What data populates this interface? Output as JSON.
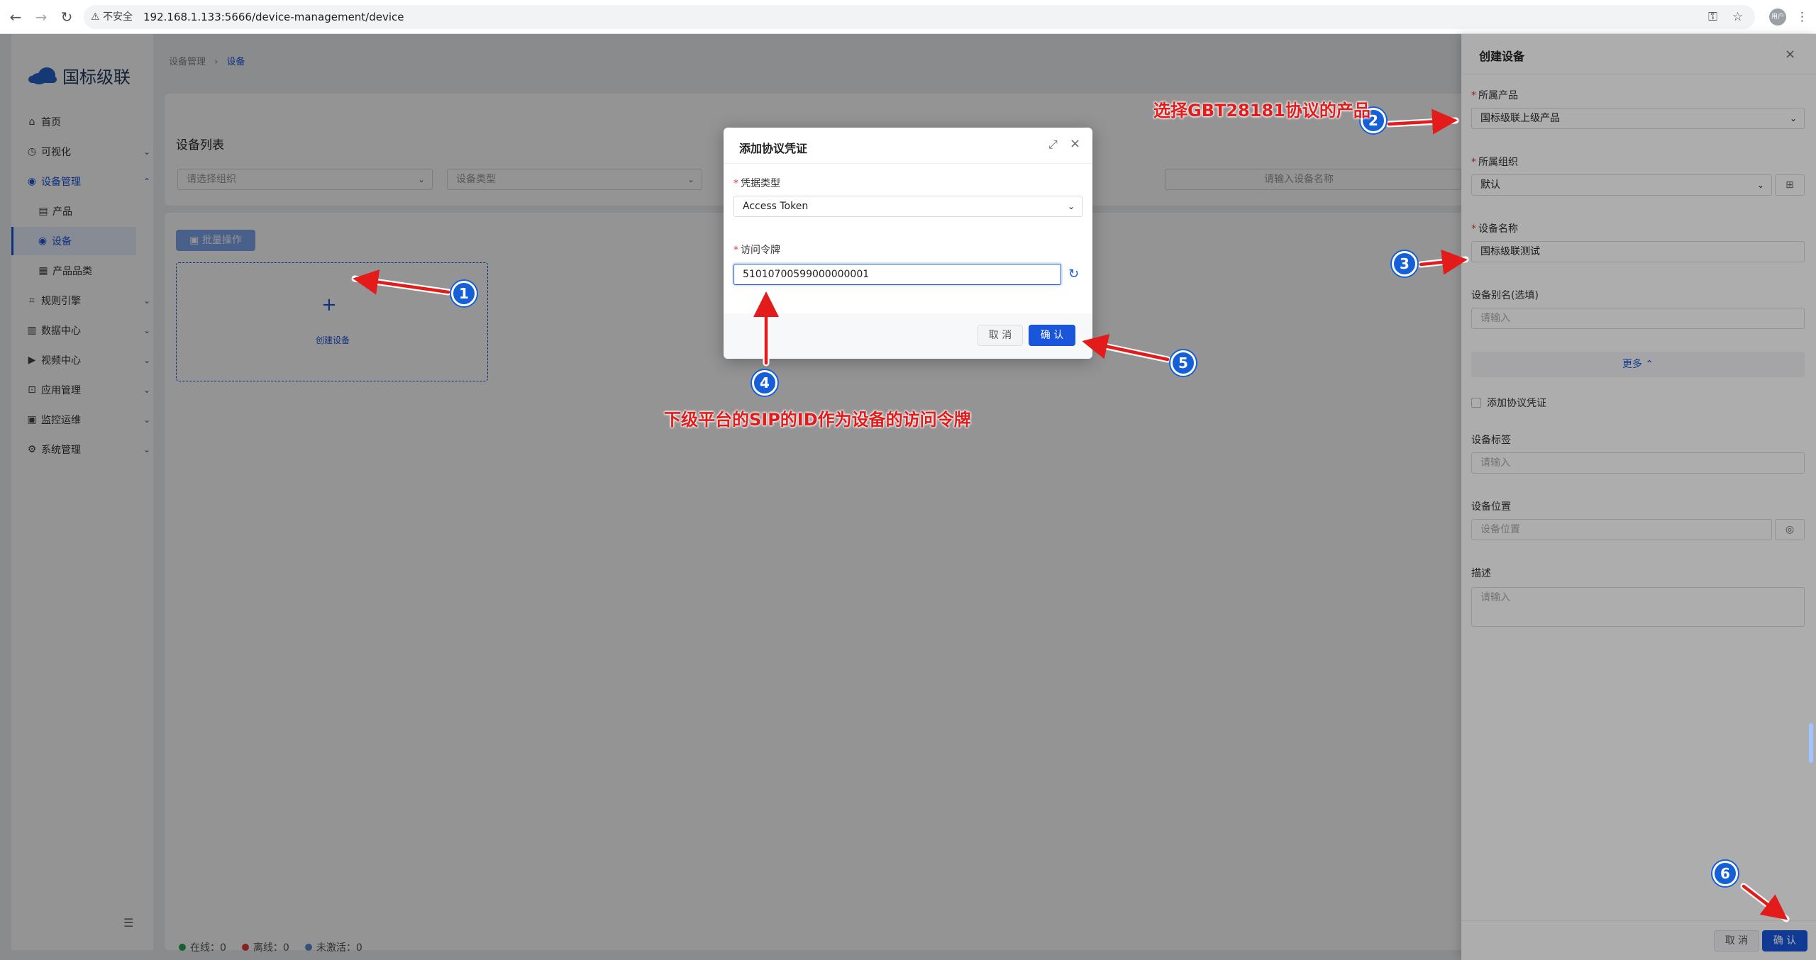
{
  "browser": {
    "insecure_label": "不安全",
    "url": "192.168.1.133:5666/device-management/device",
    "profile": "用户"
  },
  "app": {
    "logo_text": "国标级联",
    "menu": [
      {
        "label": "首页",
        "icon": "home-icon"
      },
      {
        "label": "可视化",
        "icon": "clock-icon"
      },
      {
        "label": "设备管理",
        "icon": "eye-icon"
      },
      {
        "label": "产品",
        "icon": "document-icon"
      },
      {
        "label": "设备",
        "icon": "eye-icon"
      },
      {
        "label": "产品品类",
        "icon": "category-icon"
      },
      {
        "label": "规则引擎",
        "icon": "rule-icon"
      },
      {
        "label": "数据中心",
        "icon": "chart-icon"
      },
      {
        "label": "视频中心",
        "icon": "video-icon"
      },
      {
        "label": "应用管理",
        "icon": "app-icon"
      },
      {
        "label": "监控运维",
        "icon": "monitor-icon"
      },
      {
        "label": "系统管理",
        "icon": "gear-icon"
      }
    ],
    "breadcrumb": {
      "parent": "设备管理",
      "current": "设备"
    },
    "list_title": "设备列表",
    "filters": {
      "org_placeholder": "请选择组织",
      "type_placeholder": "设备类型",
      "name_placeholder": "请输入设备名称"
    },
    "batch_button": "批量操作",
    "create_device_label": "创建设备",
    "status": {
      "online": "在线：0",
      "offline": "离线：0",
      "inactive": "未激活：0"
    }
  },
  "modal": {
    "title": "添加协议凭证",
    "cred_type_label": "凭据类型",
    "cred_type_value": "Access Token",
    "token_label": "访问令牌",
    "token_value": "51010700599000000001",
    "cancel": "取 消",
    "confirm": "确 认"
  },
  "drawer": {
    "title": "创建设备",
    "product_label": "所属产品",
    "product_value": "国标级联上级产品",
    "org_label": "所属组织",
    "org_value": "默认",
    "name_label": "设备名称",
    "name_value": "国标级联测试",
    "alias_label": "设备别名(选填)",
    "alias_placeholder": "请输入",
    "more_label": "更多",
    "add_cred_label": "添加协议凭证",
    "tag_label": "设备标签",
    "tag_placeholder": "请输入",
    "location_label": "设备位置",
    "location_placeholder": "设备位置",
    "desc_label": "描述",
    "desc_placeholder": "请输入",
    "cancel": "取 消",
    "confirm": "确 认"
  },
  "annotations": {
    "badges": [
      "1",
      "2",
      "3",
      "4",
      "5",
      "6"
    ],
    "note_product": "选择GBT28181协议的产品",
    "note_token": "下级平台的SIP的ID作为设备的访问令牌"
  },
  "colors": {
    "primary": "#1a56db",
    "annotation_red": "#e31b1b",
    "badge_blue": "#1560d9"
  }
}
